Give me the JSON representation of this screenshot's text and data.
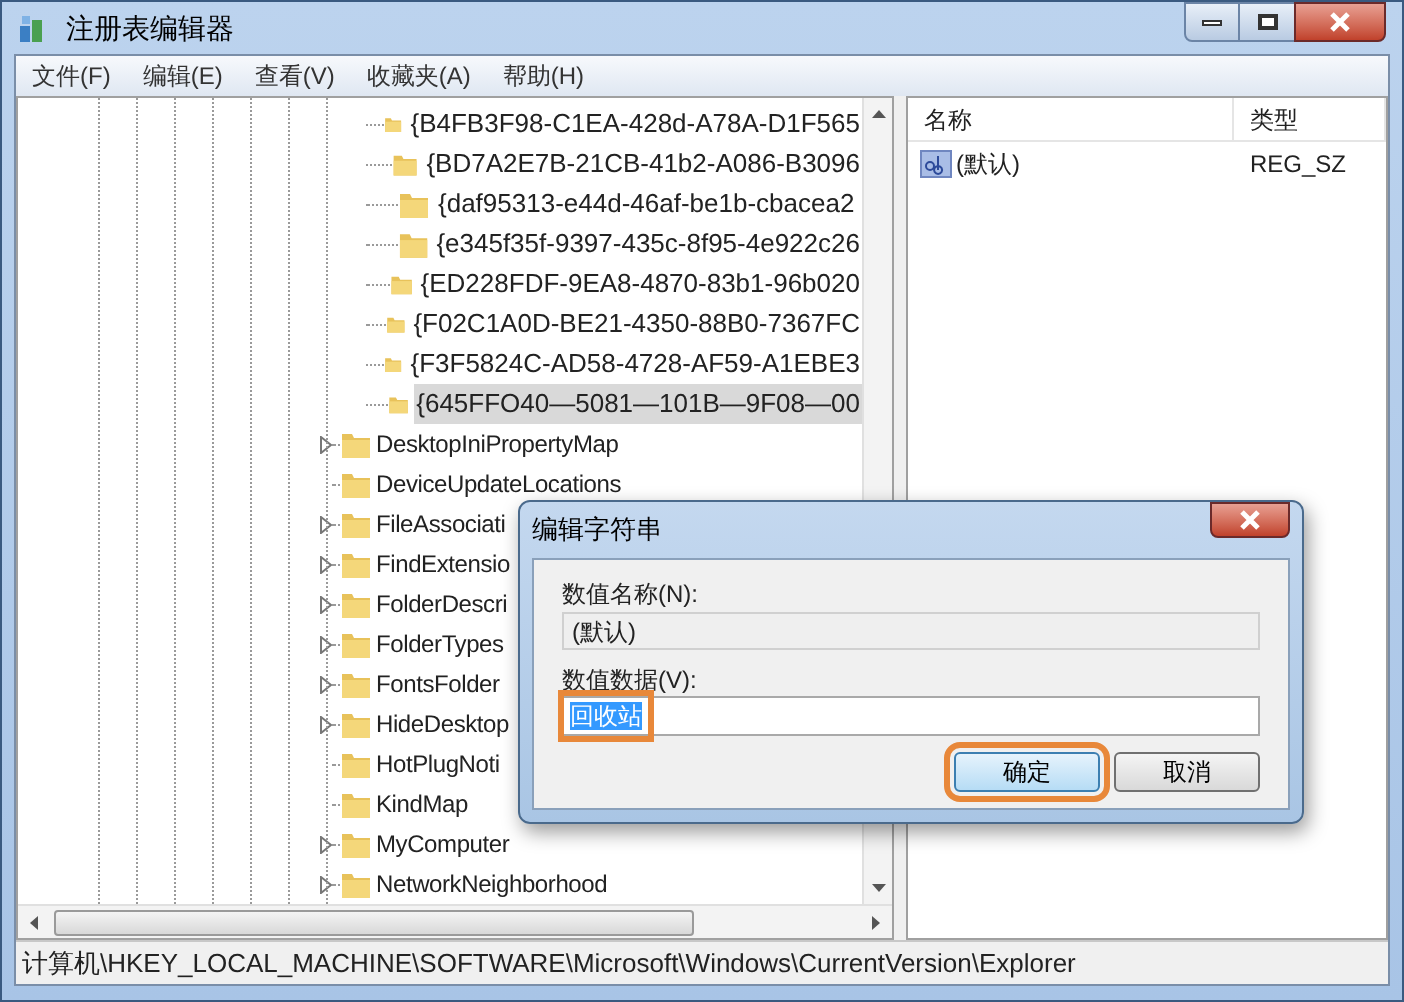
{
  "window": {
    "title": "注册表编辑器"
  },
  "menu": [
    "文件(F)",
    "编辑(E)",
    "查看(V)",
    "收藏夹(A)",
    "帮助(H)"
  ],
  "tree": {
    "sub_items": [
      {
        "label": "{B4FB3F98-C1EA-428d-A78A-D1F565",
        "selected": false
      },
      {
        "label": "{BD7A2E7B-21CB-41b2-A086-B3096",
        "selected": false
      },
      {
        "label": "{daf95313-e44d-46af-be1b-cbacea2",
        "selected": false
      },
      {
        "label": "{e345f35f-9397-435c-8f95-4e922c26",
        "selected": false
      },
      {
        "label": "{ED228FDF-9EA8-4870-83b1-96b020",
        "selected": false
      },
      {
        "label": "{F02C1A0D-BE21-4350-88B0-7367FC",
        "selected": false
      },
      {
        "label": "{F3F5824C-AD58-4728-AF59-A1EBE3",
        "selected": false
      },
      {
        "label": "{645FFO40—5081—101B—9F08—00",
        "selected": true
      }
    ],
    "items": [
      {
        "label": "DesktopIniPropertyMap",
        "has_children": true
      },
      {
        "label": "DeviceUpdateLocations",
        "has_children": false
      },
      {
        "label": "FileAssociati",
        "has_children": true
      },
      {
        "label": "FindExtensio",
        "has_children": true
      },
      {
        "label": "FolderDescri",
        "has_children": true
      },
      {
        "label": "FolderTypes",
        "has_children": true
      },
      {
        "label": "FontsFolder",
        "has_children": true
      },
      {
        "label": "HideDesktop",
        "has_children": true
      },
      {
        "label": "HotPlugNoti",
        "has_children": false
      },
      {
        "label": "KindMap",
        "has_children": false
      },
      {
        "label": "MyComputer",
        "has_children": true
      },
      {
        "label": "NetworkNeighborhood",
        "has_children": true
      }
    ]
  },
  "values": {
    "columns": [
      "名称",
      "类型"
    ],
    "rows": [
      {
        "name": "(默认)",
        "type": "REG_SZ"
      }
    ]
  },
  "status_bar": "计算机\\HKEY_LOCAL_MACHINE\\SOFTWARE\\Microsoft\\Windows\\CurrentVersion\\Explorer",
  "dialog": {
    "title": "编辑字符串",
    "name_label": "数值名称(N):",
    "name_value": "(默认)",
    "data_label": "数值数据(V):",
    "data_value": "回收站",
    "buttons": [
      {
        "label": "确定",
        "default": true
      },
      {
        "label": "取消",
        "default": false
      }
    ]
  }
}
